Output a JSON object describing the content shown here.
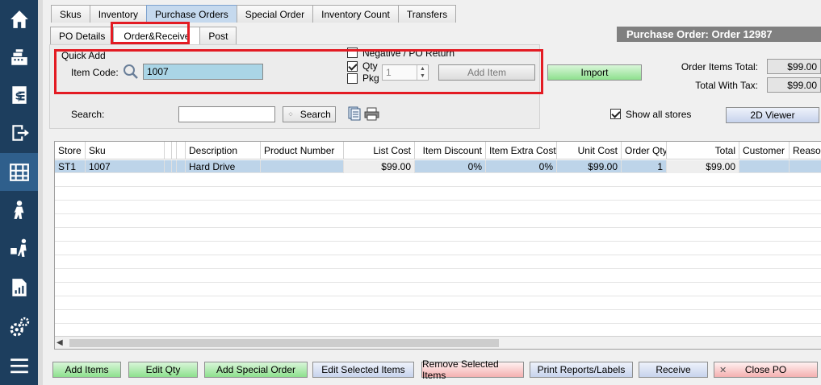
{
  "sidebar": {
    "items": [
      {
        "icon": "home-icon"
      },
      {
        "icon": "cash-register-icon"
      },
      {
        "icon": "receipt-icon"
      },
      {
        "icon": "logout-icon"
      },
      {
        "icon": "inventory-shelf-icon",
        "active": true
      },
      {
        "icon": "customer-walk-icon"
      },
      {
        "icon": "delivery-dolly-icon"
      },
      {
        "icon": "report-icon"
      },
      {
        "icon": "settings-gears-icon"
      },
      {
        "icon": "menu-icon"
      }
    ]
  },
  "main_tabs": [
    "Skus",
    "Inventory",
    "Purchase Orders",
    "Special Order",
    "Inventory Count",
    "Transfers"
  ],
  "sub_tabs": [
    "PO Details",
    "Order&Receive",
    "Post"
  ],
  "po_header": "Purchase Order:  Order 12987",
  "quick_add": {
    "title": "Quick Add",
    "item_code_label": "Item Code:",
    "item_code_value": "1007",
    "negative_label": "Negative / PO Return",
    "qty_label": "Qty",
    "pkg_label": "Pkg",
    "qty_value": "1",
    "add_item_label": "Add Item",
    "import_label": "Import"
  },
  "totals": {
    "order_items_total_label": "Order Items Total:",
    "order_items_total_value": "$99.00",
    "total_with_tax_label": "Total With Tax:",
    "total_with_tax_value": "$99.00"
  },
  "search": {
    "label": "Search:",
    "button_label": "Search",
    "show_all_stores_label": "Show all stores",
    "viewer_label": "2D Viewer"
  },
  "grid": {
    "columns": [
      "Store",
      "Sku",
      "",
      "",
      "",
      "Description",
      "Product Number",
      "List Cost",
      "Item Discount",
      "Item Extra Costs",
      "Unit Cost",
      "Order Qty",
      "Total",
      "Customer",
      "Reason"
    ],
    "rows": [
      [
        "ST1",
        "1007",
        "",
        "",
        "",
        "Hard Drive",
        "",
        "$99.00",
        "0%",
        "0%",
        "$99.00",
        "1",
        "$99.00",
        "",
        ""
      ]
    ]
  },
  "bottom_buttons": {
    "add_items": "Add Items",
    "edit_qty": "Edit Qty",
    "add_special_order": "Add Special Order",
    "edit_selected_items": "Edit Selected Items",
    "remove_selected_items": "Remove Selected Items",
    "print_reports_labels": "Print Reports/Labels",
    "receive": "Receive",
    "close_po": "Close PO"
  },
  "colors": {
    "sidebar": "#1d3e5e",
    "selected_row": "#bdd4e9",
    "highlight": "#e31b23",
    "item_code_bg": "#aad5e6"
  }
}
